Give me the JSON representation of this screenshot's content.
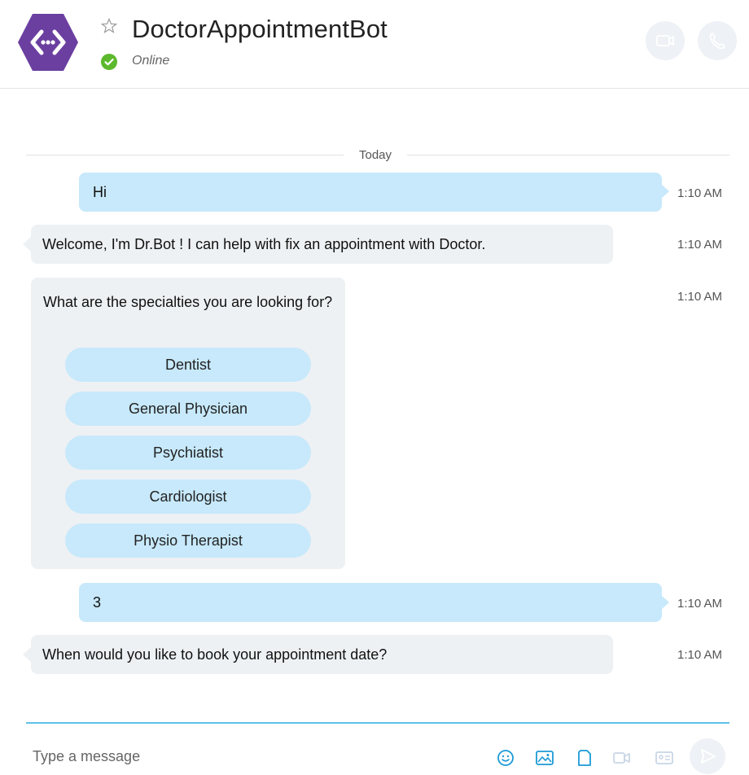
{
  "header": {
    "bot_name": "DoctorAppointmentBot",
    "status": "Online",
    "icons": {
      "avatar": "bot-avatar-icon",
      "favorite": "star-icon",
      "presence": "online-check-icon",
      "video": "video-call-icon",
      "audio": "phone-call-icon"
    }
  },
  "conversation": {
    "date_label": "Today",
    "messages": [
      {
        "direction": "outgoing",
        "text": "Hi",
        "time": "1:10 AM"
      },
      {
        "direction": "incoming",
        "text": "Welcome, I'm Dr.Bot ! I can help with fix an appointment with Doctor.",
        "time": "1:10 AM"
      },
      {
        "direction": "incoming",
        "text": "What are the specialties you are looking for?",
        "time": "1:10 AM",
        "choices": [
          "Dentist",
          "General Physician",
          "Psychiatist",
          "Cardiologist",
          "Physio Therapist"
        ]
      },
      {
        "direction": "outgoing",
        "text": "3",
        "time": "1:10 AM"
      },
      {
        "direction": "incoming",
        "text": "When would you like to book your appointment date?",
        "time": "1:10 AM"
      }
    ]
  },
  "composer": {
    "placeholder": "Type a message",
    "icons": [
      "emoji-icon",
      "image-icon",
      "file-icon",
      "video-message-icon",
      "contact-card-icon",
      "send-icon"
    ]
  },
  "colors": {
    "brand_purple": "#6b3fa0",
    "online_green": "#5cb82c",
    "outgoing_bubble": "#c7e9fb",
    "incoming_bubble": "#eef1f4",
    "accent_blue": "#1c9ad6",
    "composer_line": "#5fc1e8"
  }
}
